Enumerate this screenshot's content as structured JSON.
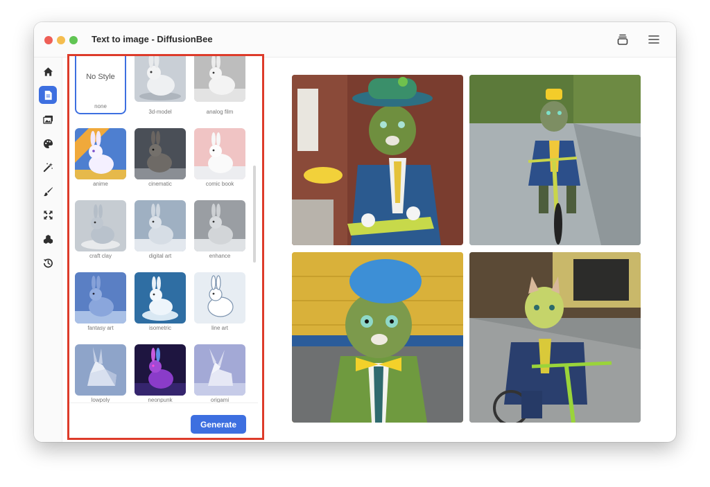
{
  "window": {
    "title": "Text to image - DiffusionBee"
  },
  "toolbar": {
    "layers_icon": "stack-icon",
    "menu_icon": "hamburger-icon"
  },
  "sidebar": {
    "items": [
      {
        "icon": "home-icon"
      },
      {
        "icon": "document-icon",
        "active": true
      },
      {
        "icon": "images-icon"
      },
      {
        "icon": "palette-icon"
      },
      {
        "icon": "magic-wand-icon"
      },
      {
        "icon": "brush-icon"
      },
      {
        "icon": "expand-icon"
      },
      {
        "icon": "cubes-icon"
      },
      {
        "icon": "history-icon"
      }
    ]
  },
  "styles": {
    "no_style_title": "No Style",
    "items": [
      {
        "label": "none",
        "selected": true
      },
      {
        "label": "3d-model"
      },
      {
        "label": "analog film"
      },
      {
        "label": "anime"
      },
      {
        "label": "cinematic"
      },
      {
        "label": "comic book"
      },
      {
        "label": "craft clay"
      },
      {
        "label": "digital art"
      },
      {
        "label": "enhance"
      },
      {
        "label": "fantasy art"
      },
      {
        "label": "isometric"
      },
      {
        "label": "line art"
      },
      {
        "label": "lowpoly"
      },
      {
        "label": "neonpunk"
      },
      {
        "label": "origami"
      }
    ]
  },
  "actions": {
    "generate_label": "Generate"
  },
  "colors": {
    "accent": "#3d6fe0",
    "highlight_border": "#dd3b2a"
  }
}
